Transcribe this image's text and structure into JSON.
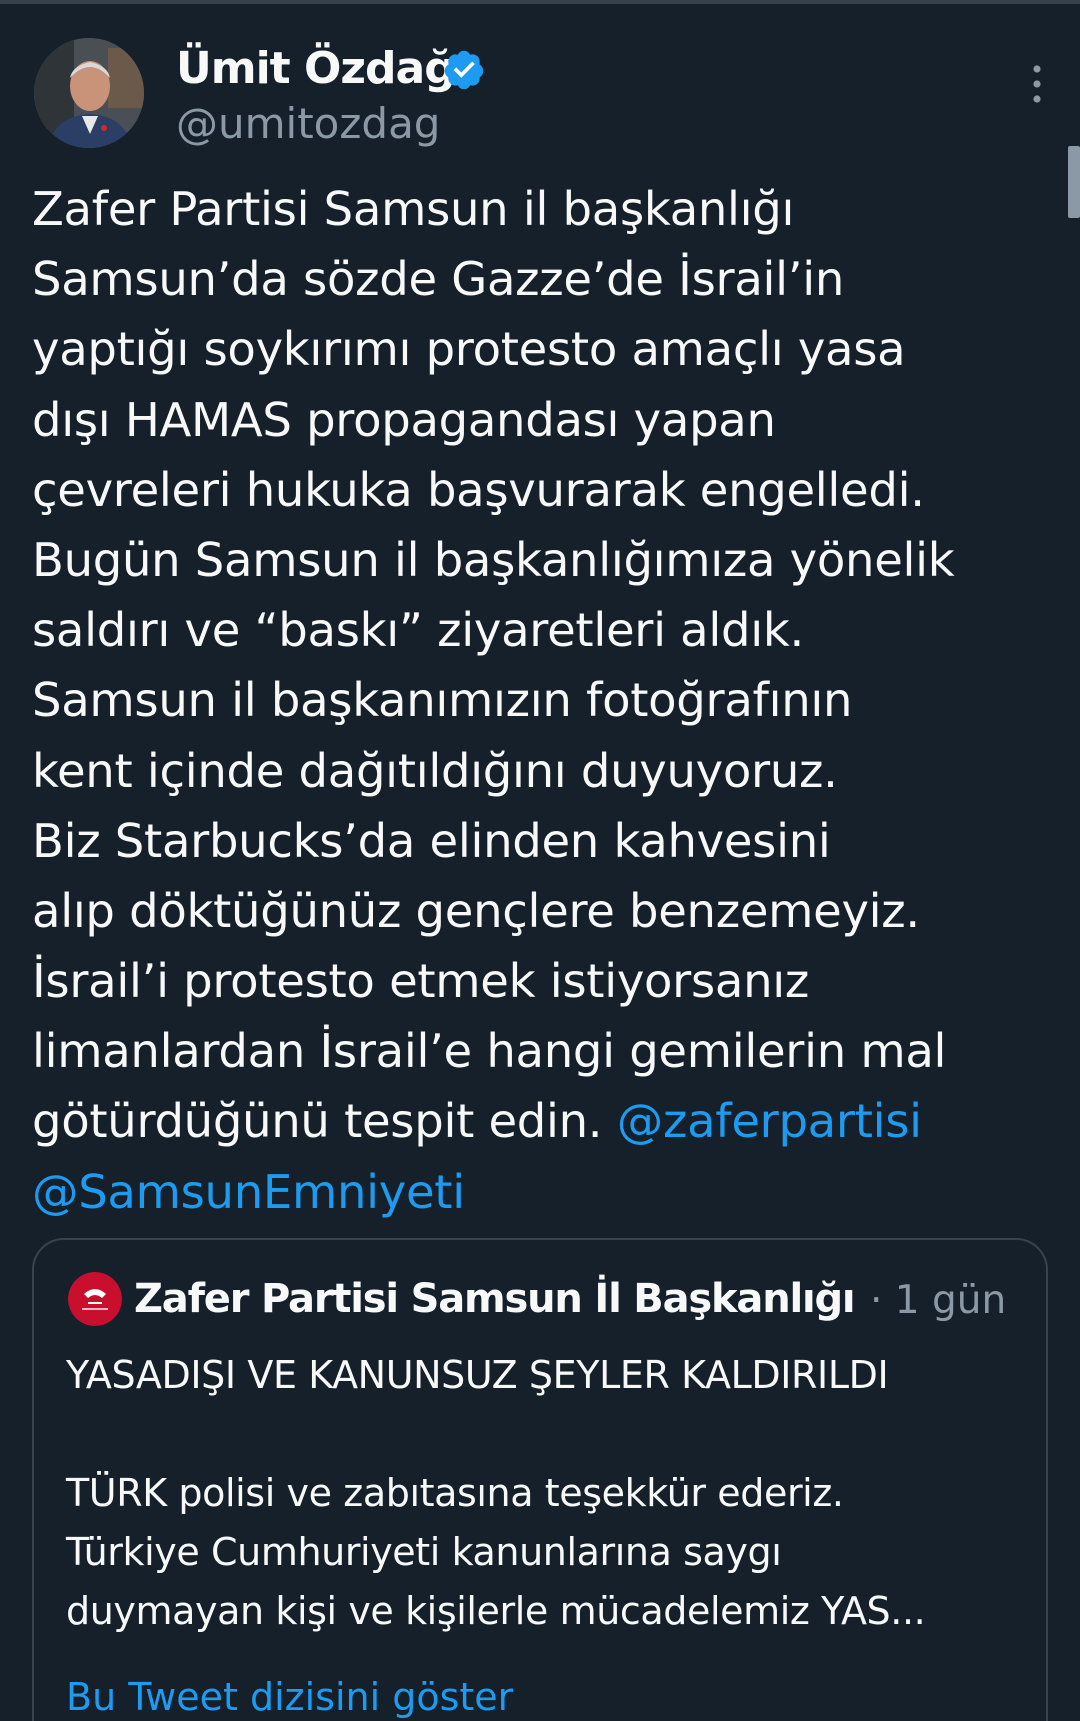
{
  "colors": {
    "background": "#15202b",
    "text": "#f7f9f9",
    "secondary_text": "#8b98a5",
    "link": "#1d9bf0",
    "border": "#38444d",
    "verified_badge": "#1d9bf0"
  },
  "tweet": {
    "author": {
      "display_name": "Ümit Özdağ",
      "handle": "@umitozdag",
      "avatar_icon": "profile-photo",
      "verified_icon": "verified-badge-icon"
    },
    "more_icon": "more-options-icon",
    "body_lines": [
      "Zafer Partisi Samsun il başkanlığı",
      "Samsun’da sözde Gazze’de İsrail’in",
      "yaptığı soykırımı protesto amaçlı yasa",
      "dışı HAMAS propagandası yapan",
      "çevreleri hukuka başvurarak engelledi.",
      "Bugün Samsun il başkanlığımıza yönelik",
      "saldırı ve “baskı” ziyaretleri aldık.",
      "Samsun il başkanımızın fotoğrafının",
      "kent içinde dağıtıldığını duyuyoruz.",
      "Biz Starbucks’da elinden kahvesini",
      "alıp döktüğünüz gençlere benzemeyiz.",
      "İsrail’i protesto etmek istiyorsanız",
      "limanlardan İsrail’e hangi gemilerin mal"
    ],
    "body_last_line_text": "götürdüğünü tespit edin. ",
    "mention_1": "@zaferpartisi",
    "mention_2": "@SamsunEmniyeti"
  },
  "quoted_tweet": {
    "author_name": "Zafer Partisi Samsun İl Başkanlığı",
    "time": "· 1 gün",
    "avatar_icon": "party-logo-icon",
    "lines": [
      "YASADIŞI VE KANUNSUZ ŞEYLER KALDIRILDI",
      "",
      "TÜRK polisi ve zabıtasına teşekkür ederiz.",
      "Türkiye Cumhuriyeti kanunlarına saygı",
      "duymayan kişi ve kişilerle mücadelemiz YAS..."
    ],
    "show_thread": "Bu Tweet dizisini göster"
  }
}
